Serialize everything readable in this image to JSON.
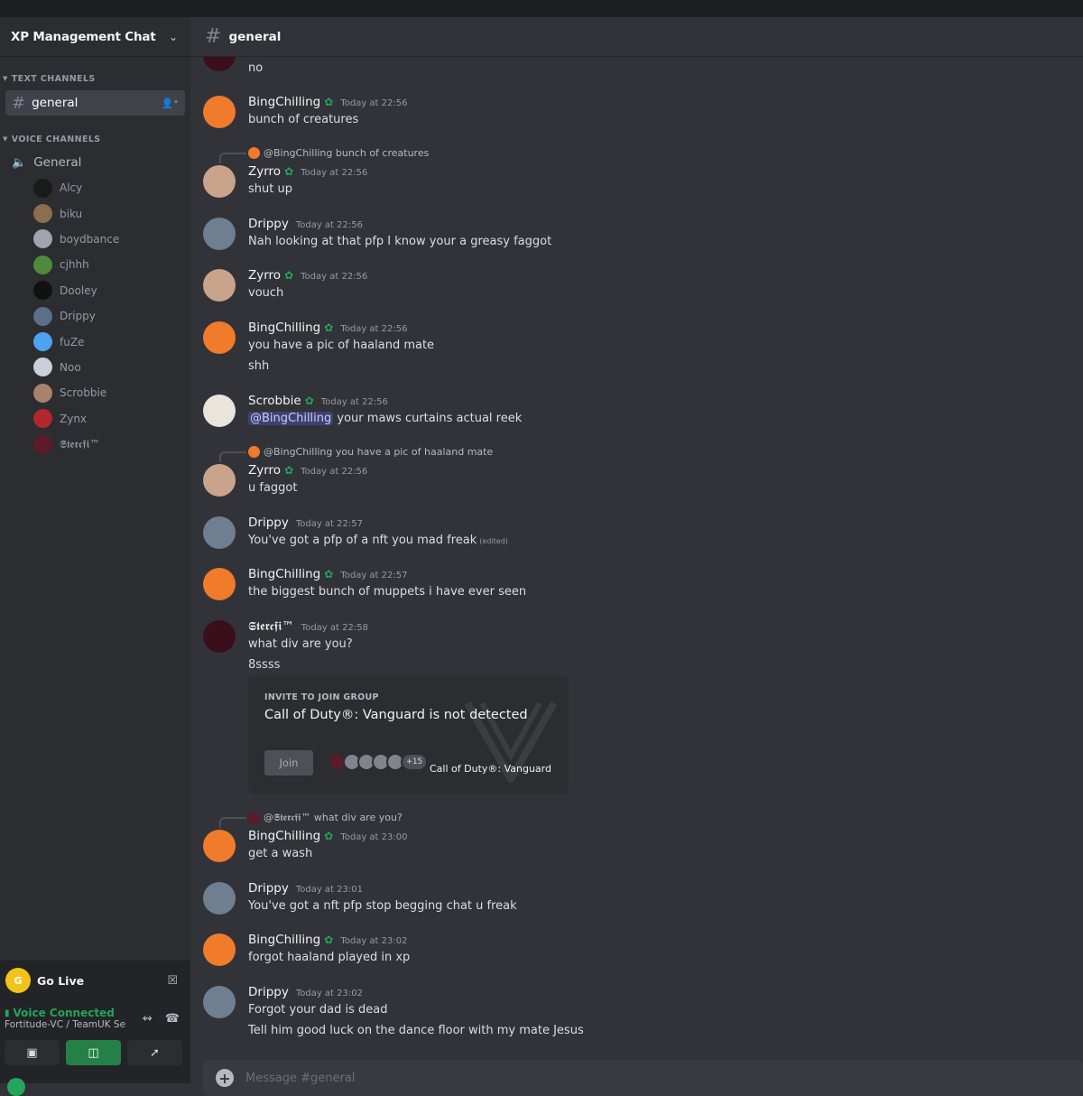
{
  "server": {
    "name": "XP Management Chat"
  },
  "categories": {
    "text": "TEXT CHANNELS",
    "voice": "VOICE CHANNELS"
  },
  "text_channel": {
    "name": "general"
  },
  "voice_channel": {
    "name": "General"
  },
  "voice_users": [
    {
      "name": "Alcy",
      "color": "#1a1a1a"
    },
    {
      "name": "biku",
      "color": "#8a6f4e"
    },
    {
      "name": "boydbance",
      "color": "#9fa4b0"
    },
    {
      "name": "cjhhh",
      "color": "#4f8a3a"
    },
    {
      "name": "Dooley",
      "color": "#111111"
    },
    {
      "name": "Drippy",
      "color": "#5b6f86"
    },
    {
      "name": "fuZe",
      "color": "#4da3f0"
    },
    {
      "name": "Noo",
      "color": "#c9d0d8"
    },
    {
      "name": "Scrobbie",
      "color": "#a8836c"
    },
    {
      "name": "Zynx",
      "color": "#b3262b"
    },
    {
      "name": "𝕾𝖙𝖊𝖗𝖈𝖋𝖎™",
      "color": "#5c1a2a"
    }
  ],
  "golive": {
    "icon_text": "G",
    "label": "Go Live"
  },
  "voice_status": {
    "label": "Voice Connected",
    "sub": "Fortitude-VC / TeamUK Se..."
  },
  "header": {
    "channel": "general"
  },
  "messages": {
    "m0": {
      "text": "no"
    },
    "m1": {
      "user": "BingChilling",
      "time": "Today at 22:56",
      "lines": [
        "bunch of creatures"
      ]
    },
    "m2": {
      "reply": "@BingChilling bunch of creatures",
      "user": "Zyrro",
      "time": "Today at 22:56",
      "lines": [
        "shut up"
      ]
    },
    "m3": {
      "user": "Drippy",
      "time": "Today at 22:56",
      "lines": [
        "Nah looking at that pfp I know your a greasy faggot"
      ]
    },
    "m4": {
      "user": "Zyrro",
      "time": "Today at 22:56",
      "lines": [
        "vouch"
      ]
    },
    "m5": {
      "user": "BingChilling",
      "time": "Today at 22:56",
      "lines": [
        "you have a pic of haaland mate",
        "shh"
      ]
    },
    "m6": {
      "user": "Scrobbie",
      "time": "Today at 22:56",
      "mention": "@BingChilling",
      "text": " your maws curtains actual reek"
    },
    "m7": {
      "reply": "@BingChilling you have a pic of haaland mate",
      "user": "Zyrro",
      "time": "Today at 22:56",
      "lines": [
        "u faggot"
      ]
    },
    "m8": {
      "user": "Drippy",
      "time": "Today at 22:57",
      "lines": [
        "You've got a pfp of a nft you mad freak"
      ],
      "edited": "(edited)"
    },
    "m9": {
      "user": "BingChilling",
      "time": "Today at 22:57",
      "lines": [
        "the biggest bunch of muppets i have ever seen"
      ]
    },
    "m10": {
      "user": "𝕾𝖙𝖊𝖗𝖈𝖋𝖎™",
      "time": "Today at 22:58",
      "lines": [
        "what div are you?",
        "8ssss"
      ]
    },
    "m11": {
      "reply": "@𝕾𝖙𝖊𝖗𝖈𝖋𝖎™ what div are you?",
      "user": "BingChilling",
      "time": "Today at 23:00",
      "lines": [
        "get a wash"
      ]
    },
    "m12": {
      "user": "Drippy",
      "time": "Today at 23:01",
      "lines": [
        "You've got a nft pfp stop begging chat u freak"
      ]
    },
    "m13": {
      "user": "BingChilling",
      "time": "Today at 23:02",
      "lines": [
        "forgot haaland played in xp"
      ]
    },
    "m14": {
      "user": "Drippy",
      "time": "Today at 23:02",
      "lines": [
        "Forgot your dad is dead",
        "Tell him good luck on the dance floor with my mate Jesus"
      ]
    }
  },
  "invite": {
    "label": "INVITE TO JOIN GROUP",
    "title": "Call of Duty®: Vanguard is not detected",
    "join": "Join",
    "count": "+15",
    "game": "Call of Duty®: Vanguard"
  },
  "composer": {
    "placeholder": "Message #general"
  },
  "colors": {
    "bing": "#f07b2a",
    "zyrro": "#c9a38c",
    "drippy": "#6e7f92",
    "scrobbie": "#e9e4dc",
    "sterc": "#3a0f1b",
    "green": "#23a55a"
  }
}
